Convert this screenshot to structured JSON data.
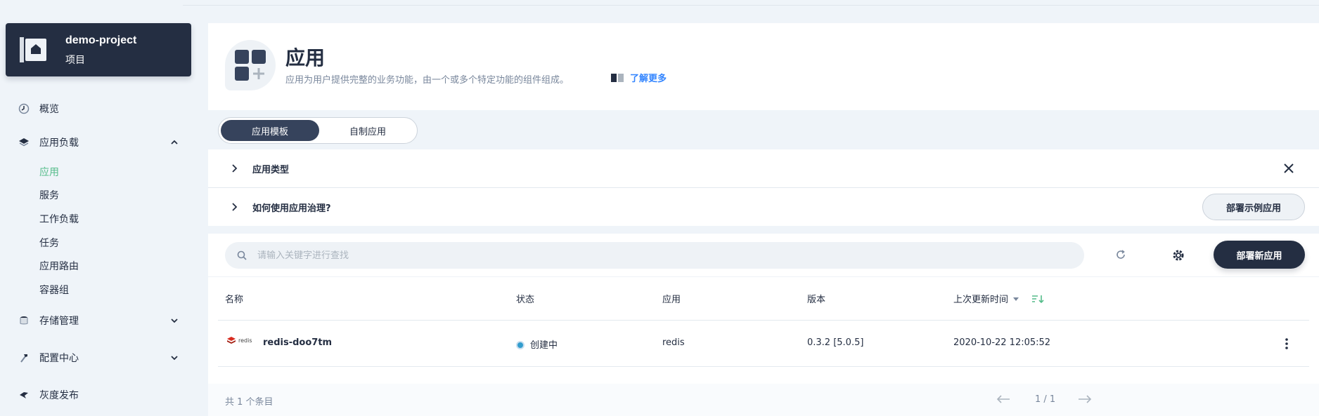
{
  "project": {
    "name": "demo-project",
    "subtitle": "项目"
  },
  "sidebar": {
    "overview": "概览",
    "workloads": "应用负载",
    "workload_children": [
      "应用",
      "服务",
      "工作负载",
      "任务",
      "应用路由",
      "容器组"
    ],
    "storage": "存储管理",
    "config": "配置中心",
    "gray": "灰度发布"
  },
  "banner": {
    "title": "应用",
    "description": "应用为用户提供完整的业务功能，由一个或多个特定功能的组件组成。",
    "learn_more": "了解更多"
  },
  "tabs": [
    "应用模板",
    "自制应用"
  ],
  "collapse": {
    "app_types": "应用类型",
    "how_to": "如何使用应用治理?",
    "deploy_sample": "部署示例应用"
  },
  "toolbar": {
    "search_placeholder": "请输入关键字进行查找",
    "deploy_new": "部署新应用"
  },
  "table": {
    "columns": [
      "名称",
      "状态",
      "应用",
      "版本",
      "上次更新时间"
    ],
    "rows": [
      {
        "logo": "redis",
        "name": "redis-doo7tm",
        "status": "创建中",
        "app": "redis",
        "version": "0.3.2 [5.0.5]",
        "updated": "2020-10-22 12:05:52"
      }
    ]
  },
  "footer": {
    "total": "共 1 个条目",
    "page": "1 / 1"
  },
  "colors": {
    "accent": "#55bc8a",
    "dark": "#242e42",
    "status": "#329dce",
    "link": "#3385ff"
  }
}
